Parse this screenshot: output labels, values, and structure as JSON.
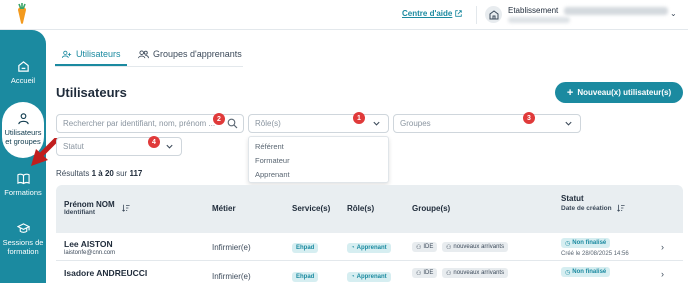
{
  "topbar": {
    "help_label": "Centre d'aide",
    "establishment_label": "Etablissement"
  },
  "sidebar": {
    "items": [
      {
        "label": "Accueil",
        "icon": "home-icon"
      },
      {
        "label": "Utilisateurs et groupes",
        "icon": "user-icon"
      },
      {
        "label": "Formations",
        "icon": "book-icon"
      },
      {
        "label": "Sessions de formation",
        "icon": "graduation-cap-icon"
      }
    ]
  },
  "tabs": [
    {
      "label": "Utilisateurs"
    },
    {
      "label": "Groupes d'apprenants"
    }
  ],
  "page": {
    "title": "Utilisateurs",
    "new_button": "Nouveau(x) utilisateur(s)"
  },
  "filters": {
    "search_placeholder": "Rechercher par identifiant, nom, prénom ...",
    "role_placeholder": "Rôle(s)",
    "groups_placeholder": "Groupes",
    "status_placeholder": "Statut",
    "role_options": [
      "Référent",
      "Formateur",
      "Apprenant"
    ]
  },
  "badges": [
    "1",
    "2",
    "3",
    "4"
  ],
  "results": {
    "prefix": "Résultats",
    "range": "1 à 20",
    "of": "sur",
    "total": "117"
  },
  "table": {
    "headers": {
      "name": "Prénom NOM",
      "identifier": "Identifiant",
      "job": "Métier",
      "services": "Service(s)",
      "roles": "Rôle(s)",
      "groups": "Groupe(s)",
      "status": "Statut",
      "creation": "Date de création"
    },
    "rows": [
      {
        "name": "Lee AISTON",
        "email": "laistonfe@cnn.com",
        "job": "Infirmier(e)",
        "service": "Ehpad",
        "role": "Apprenant",
        "groups": [
          "IDE",
          "nouveaux arrivants"
        ],
        "status": "Non finalisé",
        "created": "Créé le 28/08/2025 14:56"
      },
      {
        "name": "Isadore ANDREUCCI",
        "job": "Infirmier(e)",
        "service": "Ehpad",
        "role": "Apprenant",
        "groups": [
          "IDE",
          "nouveaux arrivants"
        ],
        "status": "Non finalisé"
      }
    ]
  },
  "colors": {
    "accent": "#1b8aa0",
    "badge": "#e03a3a",
    "header_bg": "#e9eef1"
  }
}
